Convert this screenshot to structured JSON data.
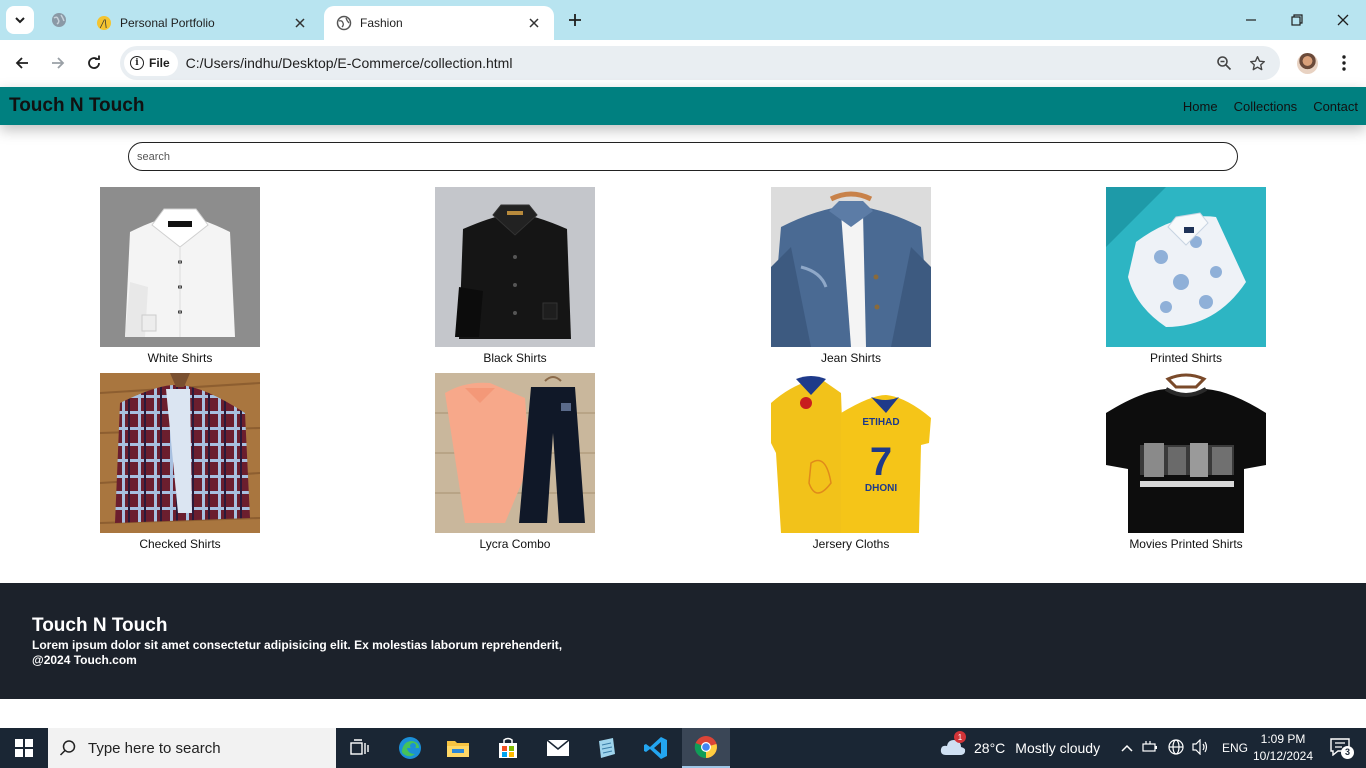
{
  "browser": {
    "tabs": [
      {
        "title": "Personal Portfolio"
      },
      {
        "title": "Fashion"
      }
    ],
    "address": {
      "chip_label": "File",
      "url": "C:/Users/indhu/Desktop/E-Commerce/collection.html"
    }
  },
  "site": {
    "brand": "Touch N Touch",
    "nav": [
      "Home",
      "Collections",
      "Contact"
    ],
    "search_placeholder": "search",
    "products": [
      {
        "name": "White Shirts"
      },
      {
        "name": "Black Shirts"
      },
      {
        "name": "Jean Shirts"
      },
      {
        "name": "Printed Shirts"
      },
      {
        "name": "Checked Shirts"
      },
      {
        "name": "Lycra Combo"
      },
      {
        "name": "Jersery Cloths"
      },
      {
        "name": "Movies Printed Shirts"
      }
    ],
    "footer": {
      "title": "Touch N Touch",
      "text": "Lorem ipsum dolor sit amet consectetur adipisicing elit. Ex molestias laborum reprehenderit,",
      "copyright": "@2024 Touch.com"
    }
  },
  "taskbar": {
    "search_placeholder": "Type here to search",
    "weather": {
      "temp": "28°C",
      "condition": "Mostly cloudy",
      "badge": "1"
    },
    "language": "ENG",
    "time": "1:09 PM",
    "date": "10/12/2024",
    "notifications": "3"
  },
  "colors": {
    "header": "#008080",
    "footer": "#1c222b",
    "tabstrip": "#b8e4f0",
    "taskbar": "#1a2634"
  }
}
